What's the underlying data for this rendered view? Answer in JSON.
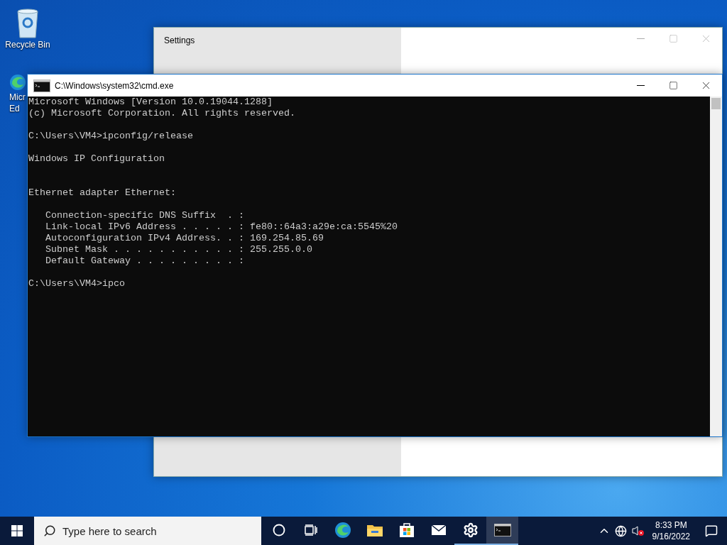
{
  "desktop_icons": [
    {
      "kind": "recycle",
      "label_lines": [
        "Recycle Bin"
      ]
    },
    {
      "kind": "edge",
      "label_lines": [
        "Micr",
        "Ed"
      ]
    }
  ],
  "settings_window": {
    "title": "Settings",
    "active": false
  },
  "cmd_window": {
    "title": "C:\\Windows\\system32\\cmd.exe",
    "active": true,
    "lines": [
      {
        "kind": "text",
        "text": "Microsoft Windows [Version 10.0.19044.1288]"
      },
      {
        "kind": "text",
        "text": "(c) Microsoft Corporation. All rights reserved."
      },
      {
        "kind": "blank"
      },
      {
        "kind": "text",
        "text": "C:\\Users\\VM4>ipconfig/release"
      },
      {
        "kind": "blank"
      },
      {
        "kind": "text",
        "text": "Windows IP Configuration"
      },
      {
        "kind": "blank"
      },
      {
        "kind": "blank"
      },
      {
        "kind": "text",
        "text": "Ethernet adapter Ethernet:"
      },
      {
        "kind": "blank"
      },
      {
        "kind": "text",
        "text": "   Connection-specific DNS Suffix  . :"
      },
      {
        "kind": "text",
        "text": "   Link-local IPv6 Address . . . . . : fe80::64a3:a29e:ca:5545%20"
      },
      {
        "kind": "text",
        "text": "   Autoconfiguration IPv4 Address. . : 169.254.85.69"
      },
      {
        "kind": "text",
        "text": "   Subnet Mask . . . . . . . . . . . : 255.255.0.0"
      },
      {
        "kind": "text",
        "text": "   Default Gateway . . . . . . . . . :"
      },
      {
        "kind": "blank"
      },
      {
        "kind": "text",
        "text": "C:\\Users\\VM4>ipco"
      }
    ]
  },
  "taskbar": {
    "search": {
      "placeholder": "Type here to search"
    },
    "apps": [
      {
        "kind": "cortana",
        "running": false,
        "active": false
      },
      {
        "kind": "taskview",
        "running": false,
        "active": false
      },
      {
        "kind": "edge",
        "running": false,
        "active": false
      },
      {
        "kind": "explorer",
        "running": false,
        "active": false
      },
      {
        "kind": "store",
        "running": false,
        "active": false
      },
      {
        "kind": "mail",
        "running": false,
        "active": false
      },
      {
        "kind": "settings",
        "running": true,
        "active": false
      },
      {
        "kind": "cmd",
        "running": true,
        "active": true
      }
    ],
    "tray": {
      "time": "8:33 PM",
      "date": "9/16/2022"
    }
  }
}
